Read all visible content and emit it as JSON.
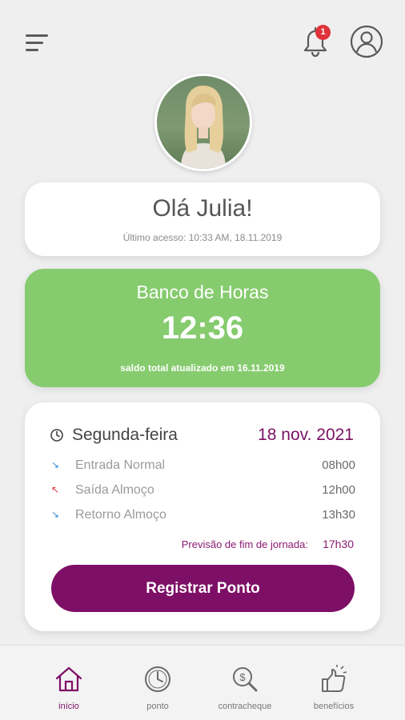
{
  "header": {
    "notification_count": "1",
    "icons": [
      "menu-icon",
      "bell-icon",
      "user-icon"
    ]
  },
  "greeting": {
    "title": "Olá Julia!",
    "last_access": "Último acesso: 10:33 AM, 18.11.2019"
  },
  "hours_bank": {
    "title": "Banco de Horas",
    "balance": "12:36",
    "subtitle": "saldo total atualizado em 16.11.2019"
  },
  "day": {
    "weekday": "Segunda-feira",
    "date": "18 nov. 2021",
    "punches": [
      {
        "label": "Entrada Normal",
        "time": "08h00",
        "direction": "in"
      },
      {
        "label": "Saída Almoço",
        "time": "12h00",
        "direction": "out"
      },
      {
        "label": "Retorno Almoço",
        "time": "13h30",
        "direction": "in"
      }
    ],
    "forecast_label": "Previsão de fim de jornada:",
    "forecast_time": "17h30",
    "register_label": "Registrar Ponto"
  },
  "bottom_nav": [
    {
      "label": "início",
      "icon": "home-icon",
      "active": true
    },
    {
      "label": "ponto",
      "icon": "clock-icon",
      "active": false
    },
    {
      "label": "contracheque",
      "icon": "money-search-icon",
      "active": false
    },
    {
      "label": "benefícios",
      "icon": "thumbs-up-icon",
      "active": false
    }
  ],
  "colors": {
    "accent": "#7e0f66",
    "bank_green": "#86cb6e",
    "badge_red": "#e0323a",
    "background": "#efeff0"
  }
}
